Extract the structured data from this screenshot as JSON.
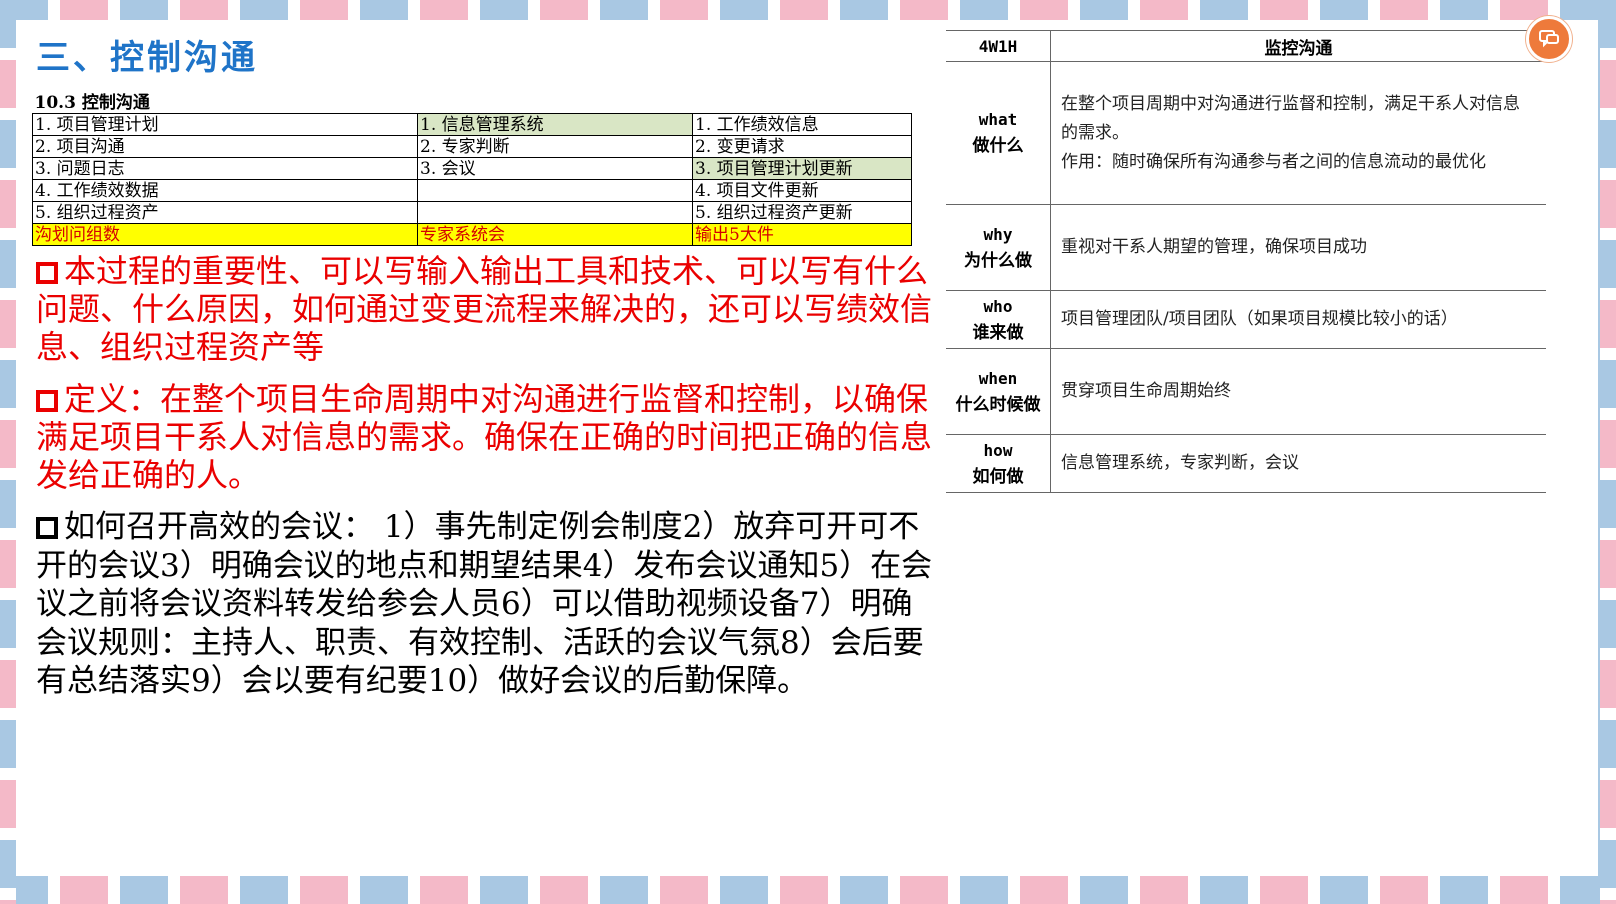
{
  "title": "三、控制沟通",
  "itto": {
    "caption": "10.3 控制沟通",
    "rows": [
      [
        "1. 项目管理计划",
        "1. 信息管理系统",
        "1. 工作绩效信息"
      ],
      [
        "2. 项目沟通",
        "2. 专家判断",
        "2. 变更请求"
      ],
      [
        "3. 问题日志",
        "3. 会议",
        "3. 项目管理计划更新"
      ],
      [
        "4. 工作绩效数据",
        "",
        "4. 项目文件更新"
      ],
      [
        "5. 组织过程资产",
        "",
        "5. 组织过程资产更新"
      ]
    ],
    "mnemonic": [
      "沟划问组数",
      "专家系统会",
      "输出5大件"
    ]
  },
  "paragraphs": {
    "importance": "本过程的重要性、可以写输入输出工具和技术、可以写有什么问题、什么原因，如何通过变更流程来解决的，还可以写绩效信息、组织过程资产等",
    "definition": "定义：在整个项目生命周期中对沟通进行监督和控制，以确保满足项目干系人对信息的需求。确保在正确的时间把正确的信息发给正确的人。",
    "meeting": "如何召开高效的会议： 1）事先制定例会制度2）放弃可开可不开的会议3）明确会议的地点和期望结果4）发布会议通知5）在会议之前将会议资料转发给参会人员6）可以借助视频设备7）明确会议规则：主持人、职责、有效控制、活跃的会议气氛8）会后要有总结落实9）会以要有纪要10）做好会议的后勤保障。"
  },
  "w4": {
    "header": [
      "4W1H",
      "监控沟通"
    ],
    "rows": [
      {
        "en": "what",
        "zh": "做什么",
        "val1": "在整个项目周期中对沟通进行监督和控制，满足干系人对信息的需求。",
        "val2": "作用：随时确保所有沟通参与者之间的信息流动的最优化"
      },
      {
        "en": "why",
        "zh": "为什么做",
        "val1": "重视对干系人期望的管理，确保项目成功"
      },
      {
        "en": "who",
        "zh": "谁来做",
        "val1": "项目管理团队/项目团队（如果项目规模比较小的话）"
      },
      {
        "en": "when",
        "zh": "什么时候做",
        "val1": "贯穿项目生命周期始终"
      },
      {
        "en": "how",
        "zh": "如何做",
        "val1": "信息管理系统，专家判断，会议"
      }
    ]
  },
  "colors": {
    "title": "#1f74c8",
    "highlight_red": "#ea0000",
    "badge": "#ee7a3b"
  },
  "icons": {
    "corner_badge": "chat-icon"
  }
}
